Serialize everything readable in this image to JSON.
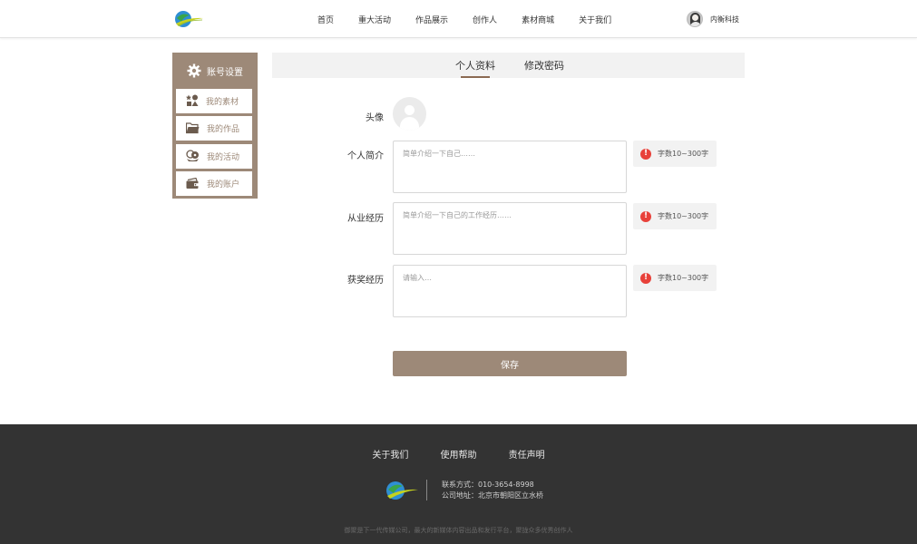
{
  "header": {
    "nav": [
      "首页",
      "重大活动",
      "作品展示",
      "创作人",
      "素材商城",
      "关于我们"
    ],
    "user_name": "内衡科技"
  },
  "sidebar": {
    "title": "账号设置",
    "items": [
      {
        "label": "我的素材",
        "icon": "materials-icon"
      },
      {
        "label": "我的作品",
        "icon": "folder-icon"
      },
      {
        "label": "我的活动",
        "icon": "activity-icon"
      },
      {
        "label": "我的账户",
        "icon": "wallet-icon"
      }
    ]
  },
  "tabs": [
    {
      "label": "个人资料",
      "active": true
    },
    {
      "label": "修改密码",
      "active": false
    }
  ],
  "form": {
    "avatar_label": "头像",
    "fields": [
      {
        "label": "个人简介",
        "placeholder": "简单介绍一下自己……",
        "hint": "字数10~300字"
      },
      {
        "label": "从业经历",
        "placeholder": "简单介绍一下自己的工作经历……",
        "hint": "字数10~300字"
      },
      {
        "label": "获奖经历",
        "placeholder": "请输入…",
        "hint": "字数10~300字"
      }
    ],
    "save_label": "保存"
  },
  "footer": {
    "links": [
      "关于我们",
      "使用帮助",
      "责任声明"
    ],
    "contact": "联系方式：010-3654-8998",
    "address": "公司地址：北京市朝阳区立水桥",
    "slogan": "御聚是下一代传媒公司，最大的新媒体内容出品和发行平台，聚拢众多优秀创作人"
  },
  "colors": {
    "accent": "#9d8978",
    "tab_underline": "#8b6a52",
    "warn": "#e8413a",
    "footer_bg": "#333333"
  }
}
